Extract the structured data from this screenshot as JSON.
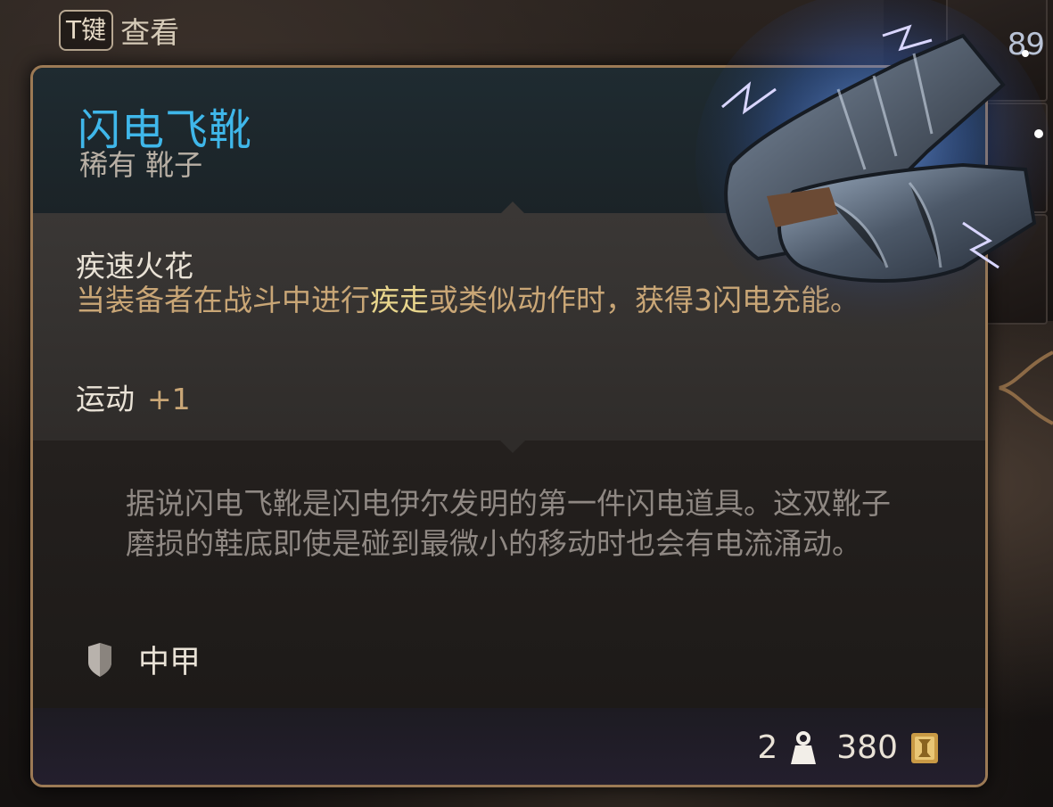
{
  "hint": {
    "key": "T键",
    "label": "查看"
  },
  "inventory": {
    "stack_count": "89"
  },
  "item": {
    "name": "闪电飞靴",
    "rarity_type": "稀有 靴子",
    "effect_title": "疾速火花",
    "effect_desc_pre": "当装备者在战斗中进行",
    "effect_desc_highlight": "疾走",
    "effect_desc_post": "或类似动作时，获得3闪电充能。",
    "stat_name": "运动",
    "stat_value": "+1",
    "lore": "据说闪电飞靴是闪电伊尔发明的第一件闪电道具。这双靴子磨损的鞋底即使是碰到最微小的移动时也会有电流涌动。",
    "armor_type": "中甲",
    "weight": "2",
    "value": "380"
  },
  "colors": {
    "name": "#3fb7ea",
    "desc": "#c9a676",
    "highlight": "#e8d58c",
    "border": "#9c7a55"
  },
  "icons": [
    "shield-icon",
    "weight-icon",
    "gold-coin-icon",
    "boots-item-image"
  ]
}
